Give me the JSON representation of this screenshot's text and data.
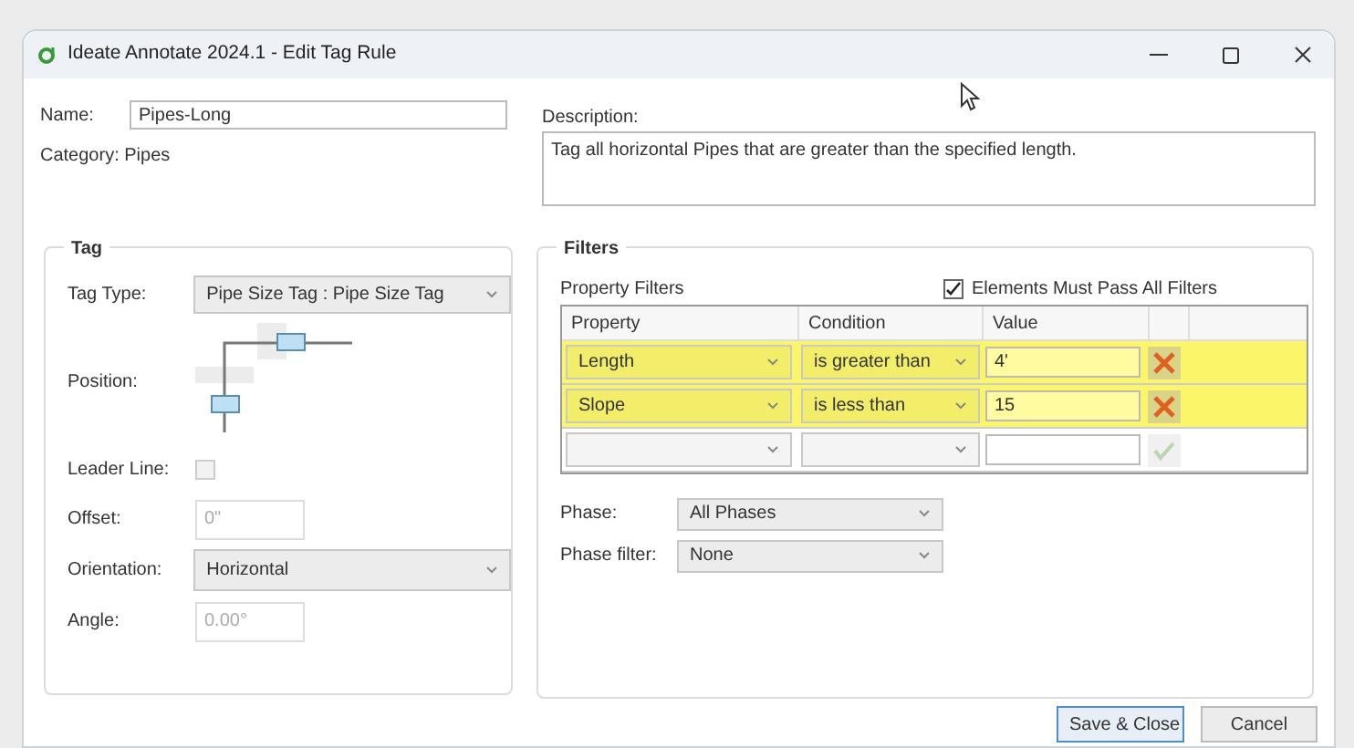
{
  "window": {
    "title": "Ideate Annotate 2024.1 - Edit Tag Rule"
  },
  "name": {
    "label": "Name:",
    "value": "Pipes-Long"
  },
  "category": "Category: Pipes",
  "description": {
    "label": "Description:",
    "value": "Tag all horizontal Pipes that are greater than the specified length."
  },
  "tag": {
    "title": "Tag",
    "tag_type": {
      "label": "Tag Type:",
      "value": "Pipe Size Tag : Pipe Size Tag"
    },
    "position": {
      "label": "Position:"
    },
    "leader_line": {
      "label": "Leader Line:",
      "checked": false
    },
    "offset": {
      "label": "Offset:",
      "placeholder": "0\""
    },
    "orientation": {
      "label": "Orientation:",
      "value": "Horizontal"
    },
    "angle": {
      "label": "Angle:",
      "placeholder": "0.00°"
    }
  },
  "filters": {
    "title": "Filters",
    "property_filters_label": "Property Filters",
    "must_pass_all": {
      "label": "Elements Must Pass All Filters",
      "checked": true
    },
    "columns": [
      "Property",
      "Condition",
      "Value"
    ],
    "rows": [
      {
        "property": "Length",
        "condition": "is greater than",
        "value": "4'",
        "highlighted": true,
        "kind": "filter"
      },
      {
        "property": "Slope",
        "condition": "is less than",
        "value": "15",
        "highlighted": true,
        "kind": "filter"
      },
      {
        "highlighted": false,
        "kind": "new"
      }
    ],
    "phase": {
      "label": "Phase:",
      "value": "All Phases"
    },
    "phase_filter": {
      "label": "Phase filter:",
      "value": "None"
    }
  },
  "buttons": [
    "Save & Close",
    "Cancel"
  ]
}
